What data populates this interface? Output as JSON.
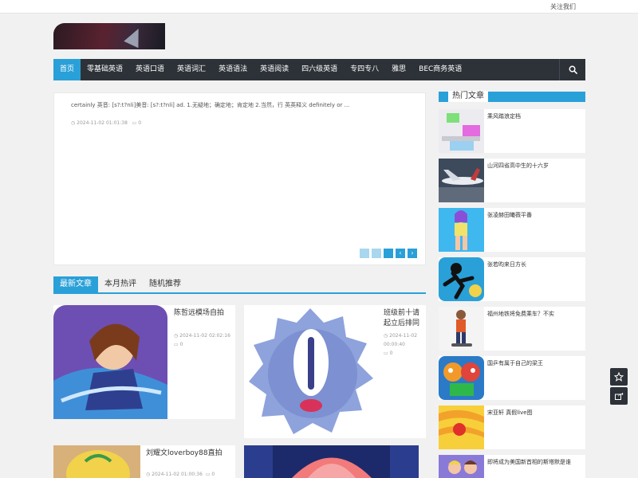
{
  "topbar": {
    "follow_label": "关注我们"
  },
  "nav": {
    "items": [
      "首页",
      "零基础英语",
      "英语口语",
      "英语词汇",
      "英语语法",
      "英语阅读",
      "四六级英语",
      "专四专八",
      "雅思",
      "BEC商务英语"
    ],
    "active_index": 0
  },
  "slider": {
    "excerpt": "certainly 英音: [s?:t?nli]美音: [s?:t?nli]   ad. 1.无疑地；确定地；肯定地 2.当然，行 英英释义 definitely or ...",
    "date": "2024-11-02 01:01:38",
    "comments": "0",
    "prev_arrow": "‹",
    "next_arrow": "›"
  },
  "tabs": [
    "最新文章",
    "本月热评",
    "随机推荐"
  ],
  "posts": [
    {
      "title": "陈哲远模场自拍",
      "date": "2024-11-02 02:02:16",
      "comments": "0"
    },
    {
      "title": "班级前十请起立后排同",
      "date": "2024-11-02 00:00:40",
      "comments": "0"
    },
    {
      "title": "刘耀文loverboy88直拍",
      "date": "2024-11-02 01:00:36",
      "comments": "0"
    },
    {
      "title": "",
      "date": "",
      "comments": ""
    }
  ],
  "sidebar": {
    "heading": "热门文章",
    "items": [
      {
        "title": "乘风踏浪定档"
      },
      {
        "title": "山河四省高中生的十六岁"
      },
      {
        "title": "张凌赫田曦薇平番"
      },
      {
        "title": "张若昀来日方长"
      },
      {
        "title": "福州地铁将免费乘车？不实"
      },
      {
        "title": "国乒有属于自己的梁王"
      },
      {
        "title": "宋亚轩 真假live图"
      },
      {
        "title": "即将成为美国新首相的斯塔默是谁"
      }
    ]
  },
  "colors": {
    "accent": "#2aa0d8",
    "nav_bg": "#2d3238",
    "page_bg": "#f1f1f1"
  },
  "icons": [
    "search-icon",
    "clock-icon",
    "comment-icon",
    "star-icon",
    "share-icon"
  ]
}
